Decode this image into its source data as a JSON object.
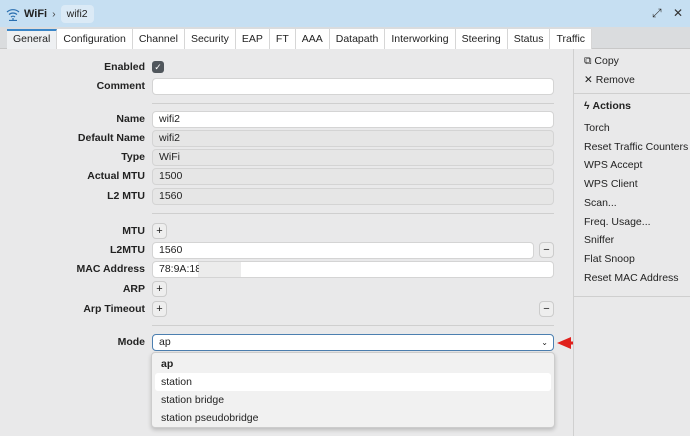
{
  "titlebar": {
    "app": "WiFi",
    "separator": "›",
    "item": "wifi2",
    "restore": "⤢",
    "close": "✕"
  },
  "tabs": [
    "General",
    "Configuration",
    "Channel",
    "Security",
    "EAP",
    "FT",
    "AAA",
    "Datapath",
    "Interworking",
    "Steering",
    "Status",
    "Traffic"
  ],
  "form": {
    "enabled": {
      "label": "Enabled",
      "checked": true
    },
    "comment": {
      "label": "Comment",
      "value": ""
    },
    "name": {
      "label": "Name",
      "value": "wifi2"
    },
    "default_name": {
      "label": "Default Name",
      "value": "wifi2"
    },
    "type": {
      "label": "Type",
      "value": "WiFi"
    },
    "actual_mtu": {
      "label": "Actual MTU",
      "value": "1500"
    },
    "l2_mtu": {
      "label": "L2 MTU",
      "value": "1560"
    },
    "mtu": {
      "label": "MTU"
    },
    "l2mtu": {
      "label": "L2MTU",
      "value": "1560"
    },
    "mac": {
      "label": "MAC Address",
      "value": "78:9A:18"
    },
    "arp": {
      "label": "ARP"
    },
    "arp_timeout": {
      "label": "Arp Timeout"
    },
    "mode": {
      "label": "Mode",
      "value": "ap",
      "options": [
        "ap",
        "station",
        "station bridge",
        "station pseudobridge"
      ]
    }
  },
  "sidebar": {
    "copy": "Copy",
    "remove": "Remove",
    "actions_title": "Actions",
    "actions": [
      "Torch",
      "Reset Traffic Counters",
      "WPS Accept",
      "WPS Client",
      "Scan...",
      "Freq. Usage...",
      "Sniffer",
      "Flat Snoop",
      "Reset MAC Address"
    ]
  },
  "annotation": {
    "arrow_color": "#e0201c"
  }
}
